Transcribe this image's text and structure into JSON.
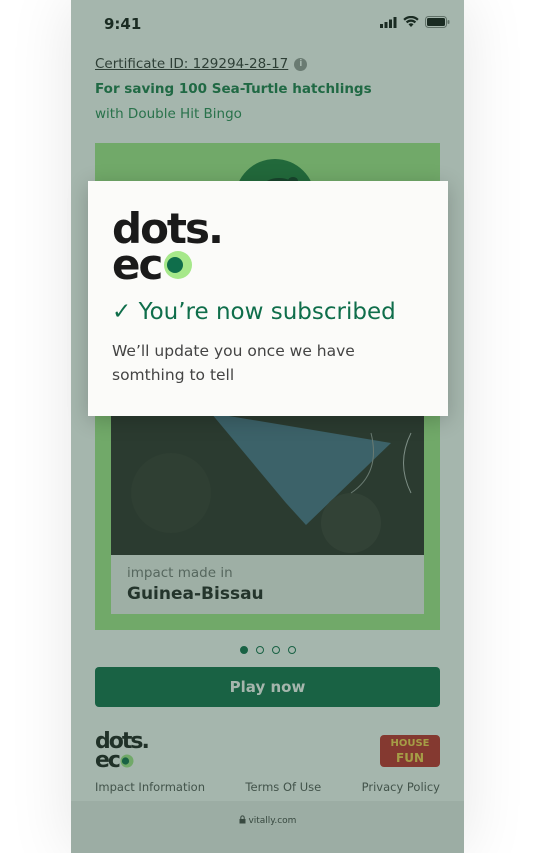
{
  "status_bar": {
    "time": "9:41"
  },
  "certificate": {
    "id_text": "Certificate ID: 129294-28-17",
    "title": "For saving 100 Sea-Turtle hatchlings",
    "subtitle": "with Double Hit Bingo"
  },
  "card": {
    "impact_label": "impact made in",
    "impact_place": "Guinea-Bissau",
    "bg_color": "#a6e88a"
  },
  "carousel": {
    "total": 4,
    "active_index": 0
  },
  "play_button": {
    "label": "Play now",
    "color": "#0f6e4b"
  },
  "footer": {
    "logo_line1": "dots.",
    "logo_line2": "ec",
    "partner_logo_line1": "HOUSE",
    "partner_logo_line2": "FUN",
    "links": [
      "Impact Information",
      "Terms Of Use",
      "Privacy Policy"
    ]
  },
  "browser": {
    "url": "vitally.com"
  },
  "modal": {
    "logo_line1": "dots.",
    "logo_line2": "ec",
    "check_icon": "✓",
    "title": "You’re now subscribed",
    "body": "We’ll update you once we have somthing to tell"
  }
}
